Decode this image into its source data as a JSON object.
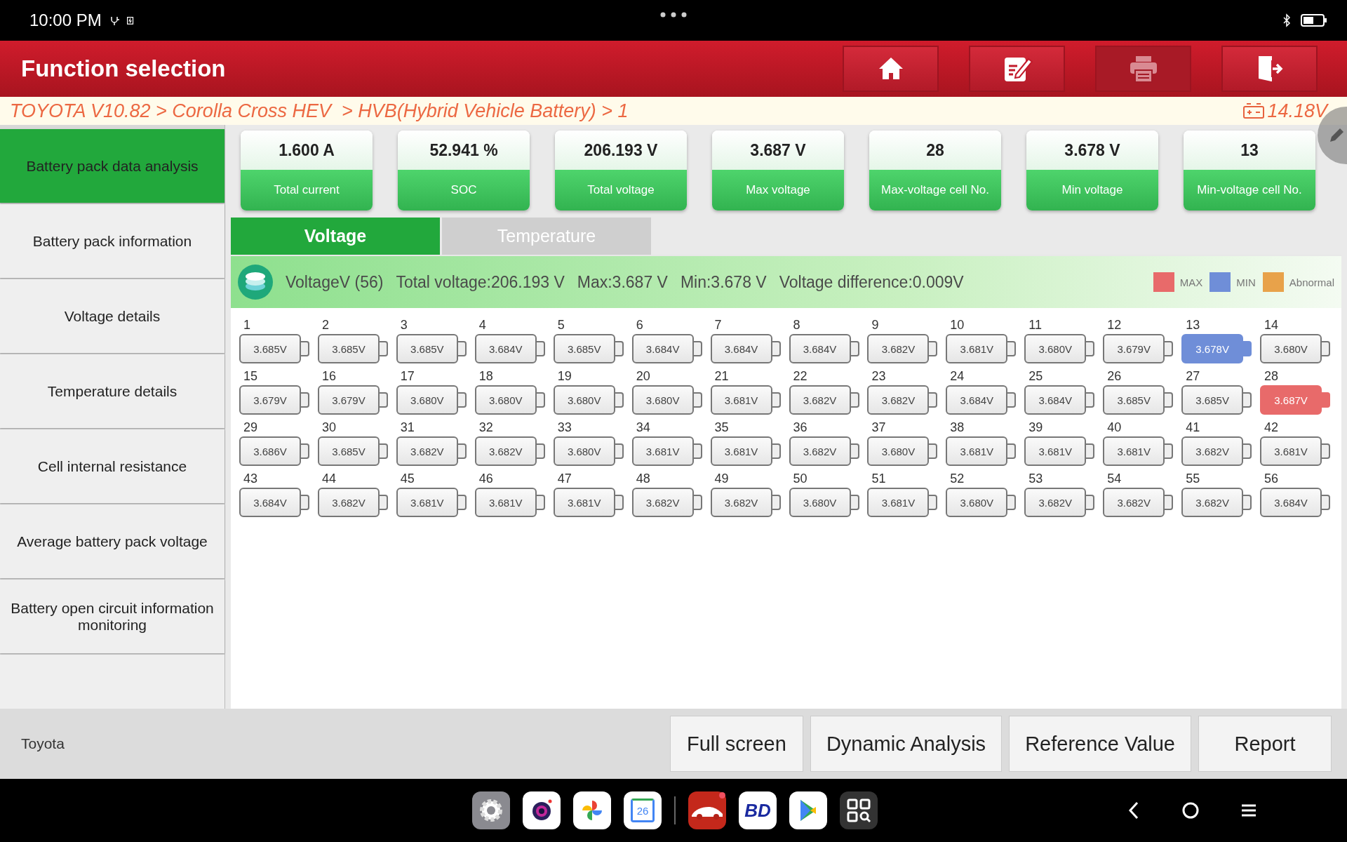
{
  "status_bar": {
    "time": "10:00 PM"
  },
  "header": {
    "title": "Function selection",
    "buttons": [
      {
        "kind": "home",
        "disabled": false
      },
      {
        "kind": "edit",
        "disabled": false
      },
      {
        "kind": "print",
        "disabled": true
      },
      {
        "kind": "exit",
        "disabled": false
      }
    ]
  },
  "breadcrumb": {
    "path": "TOYOTA V10.82 > Corolla Cross HEV  > HVB(Hybrid Vehicle Battery) > 1",
    "battery_voltage": "14.18V"
  },
  "sidebar": {
    "items": [
      {
        "label": "Battery pack data analysis",
        "selected": true
      },
      {
        "label": "Battery pack information",
        "selected": false
      },
      {
        "label": "Voltage details",
        "selected": false
      },
      {
        "label": "Temperature details",
        "selected": false
      },
      {
        "label": "Cell internal resistance",
        "selected": false
      },
      {
        "label": "Average battery pack voltage",
        "selected": false
      },
      {
        "label": "Battery open circuit information monitoring",
        "selected": false
      }
    ]
  },
  "stats": [
    {
      "value": "1.600 A",
      "label": "Total current"
    },
    {
      "value": "52.941 %",
      "label": "SOC"
    },
    {
      "value": "206.193 V",
      "label": "Total voltage"
    },
    {
      "value": "3.687 V",
      "label": "Max voltage"
    },
    {
      "value": "28",
      "label": "Max-voltage cell No."
    },
    {
      "value": "3.678 V",
      "label": "Min voltage"
    },
    {
      "value": "13",
      "label": "Min-voltage cell No."
    }
  ],
  "tabs": [
    {
      "label": "Voltage",
      "selected": true
    },
    {
      "label": "Temperature",
      "selected": false
    }
  ],
  "summary": {
    "title": "VoltageV (56)",
    "total": "Total voltage:206.193 V",
    "max": "Max:3.687 V",
    "min": "Min:3.678 V",
    "difference": "Voltage difference:0.009V"
  },
  "legend": [
    {
      "kind": "max",
      "label": "MAX",
      "color": "#e86a6a"
    },
    {
      "kind": "min",
      "label": "MIN",
      "color": "#6f8ed8"
    },
    {
      "kind": "abnormal",
      "label": "Abnormal",
      "color": "#e8a24a"
    }
  ],
  "cells": [
    {
      "number": "1",
      "value": "3.685V",
      "kind": "normal"
    },
    {
      "number": "2",
      "value": "3.685V",
      "kind": "normal"
    },
    {
      "number": "3",
      "value": "3.685V",
      "kind": "normal"
    },
    {
      "number": "4",
      "value": "3.684V",
      "kind": "normal"
    },
    {
      "number": "5",
      "value": "3.685V",
      "kind": "normal"
    },
    {
      "number": "6",
      "value": "3.684V",
      "kind": "normal"
    },
    {
      "number": "7",
      "value": "3.684V",
      "kind": "normal"
    },
    {
      "number": "8",
      "value": "3.684V",
      "kind": "normal"
    },
    {
      "number": "9",
      "value": "3.682V",
      "kind": "normal"
    },
    {
      "number": "10",
      "value": "3.681V",
      "kind": "normal"
    },
    {
      "number": "11",
      "value": "3.680V",
      "kind": "normal"
    },
    {
      "number": "12",
      "value": "3.679V",
      "kind": "normal"
    },
    {
      "number": "13",
      "value": "3.678V",
      "kind": "min"
    },
    {
      "number": "14",
      "value": "3.680V",
      "kind": "normal"
    },
    {
      "number": "15",
      "value": "3.679V",
      "kind": "normal"
    },
    {
      "number": "16",
      "value": "3.679V",
      "kind": "normal"
    },
    {
      "number": "17",
      "value": "3.680V",
      "kind": "normal"
    },
    {
      "number": "18",
      "value": "3.680V",
      "kind": "normal"
    },
    {
      "number": "19",
      "value": "3.680V",
      "kind": "normal"
    },
    {
      "number": "20",
      "value": "3.680V",
      "kind": "normal"
    },
    {
      "number": "21",
      "value": "3.681V",
      "kind": "normal"
    },
    {
      "number": "22",
      "value": "3.682V",
      "kind": "normal"
    },
    {
      "number": "23",
      "value": "3.682V",
      "kind": "normal"
    },
    {
      "number": "24",
      "value": "3.684V",
      "kind": "normal"
    },
    {
      "number": "25",
      "value": "3.684V",
      "kind": "normal"
    },
    {
      "number": "26",
      "value": "3.685V",
      "kind": "normal"
    },
    {
      "number": "27",
      "value": "3.685V",
      "kind": "normal"
    },
    {
      "number": "28",
      "value": "3.687V",
      "kind": "max"
    },
    {
      "number": "29",
      "value": "3.686V",
      "kind": "normal"
    },
    {
      "number": "30",
      "value": "3.685V",
      "kind": "normal"
    },
    {
      "number": "31",
      "value": "3.682V",
      "kind": "normal"
    },
    {
      "number": "32",
      "value": "3.682V",
      "kind": "normal"
    },
    {
      "number": "33",
      "value": "3.680V",
      "kind": "normal"
    },
    {
      "number": "34",
      "value": "3.681V",
      "kind": "normal"
    },
    {
      "number": "35",
      "value": "3.681V",
      "kind": "normal"
    },
    {
      "number": "36",
      "value": "3.682V",
      "kind": "normal"
    },
    {
      "number": "37",
      "value": "3.680V",
      "kind": "normal"
    },
    {
      "number": "38",
      "value": "3.681V",
      "kind": "normal"
    },
    {
      "number": "39",
      "value": "3.681V",
      "kind": "normal"
    },
    {
      "number": "40",
      "value": "3.681V",
      "kind": "normal"
    },
    {
      "number": "41",
      "value": "3.682V",
      "kind": "normal"
    },
    {
      "number": "42",
      "value": "3.681V",
      "kind": "normal"
    },
    {
      "number": "43",
      "value": "3.684V",
      "kind": "normal"
    },
    {
      "number": "44",
      "value": "3.682V",
      "kind": "normal"
    },
    {
      "number": "45",
      "value": "3.681V",
      "kind": "normal"
    },
    {
      "number": "46",
      "value": "3.681V",
      "kind": "normal"
    },
    {
      "number": "47",
      "value": "3.681V",
      "kind": "normal"
    },
    {
      "number": "48",
      "value": "3.682V",
      "kind": "normal"
    },
    {
      "number": "49",
      "value": "3.682V",
      "kind": "normal"
    },
    {
      "number": "50",
      "value": "3.680V",
      "kind": "normal"
    },
    {
      "number": "51",
      "value": "3.681V",
      "kind": "normal"
    },
    {
      "number": "52",
      "value": "3.680V",
      "kind": "normal"
    },
    {
      "number": "53",
      "value": "3.682V",
      "kind": "normal"
    },
    {
      "number": "54",
      "value": "3.682V",
      "kind": "normal"
    },
    {
      "number": "55",
      "value": "3.682V",
      "kind": "normal"
    },
    {
      "number": "56",
      "value": "3.684V",
      "kind": "normal"
    }
  ],
  "footer": {
    "brand": "Toyota",
    "buttons": [
      "Full screen",
      "Dynamic Analysis",
      "Reference Value",
      "Report"
    ]
  },
  "dock": {
    "apps": [
      {
        "kind": "settings",
        "badge": false
      },
      {
        "kind": "camera",
        "badge": false
      },
      {
        "kind": "photos",
        "badge": false
      },
      {
        "kind": "calendar",
        "text": "26",
        "badge": false
      },
      {
        "kind": "car",
        "badge": true
      },
      {
        "kind": "bd",
        "text": "BD",
        "badge": false
      },
      {
        "kind": "play",
        "badge": false
      },
      {
        "kind": "apps",
        "badge": false
      }
    ]
  }
}
